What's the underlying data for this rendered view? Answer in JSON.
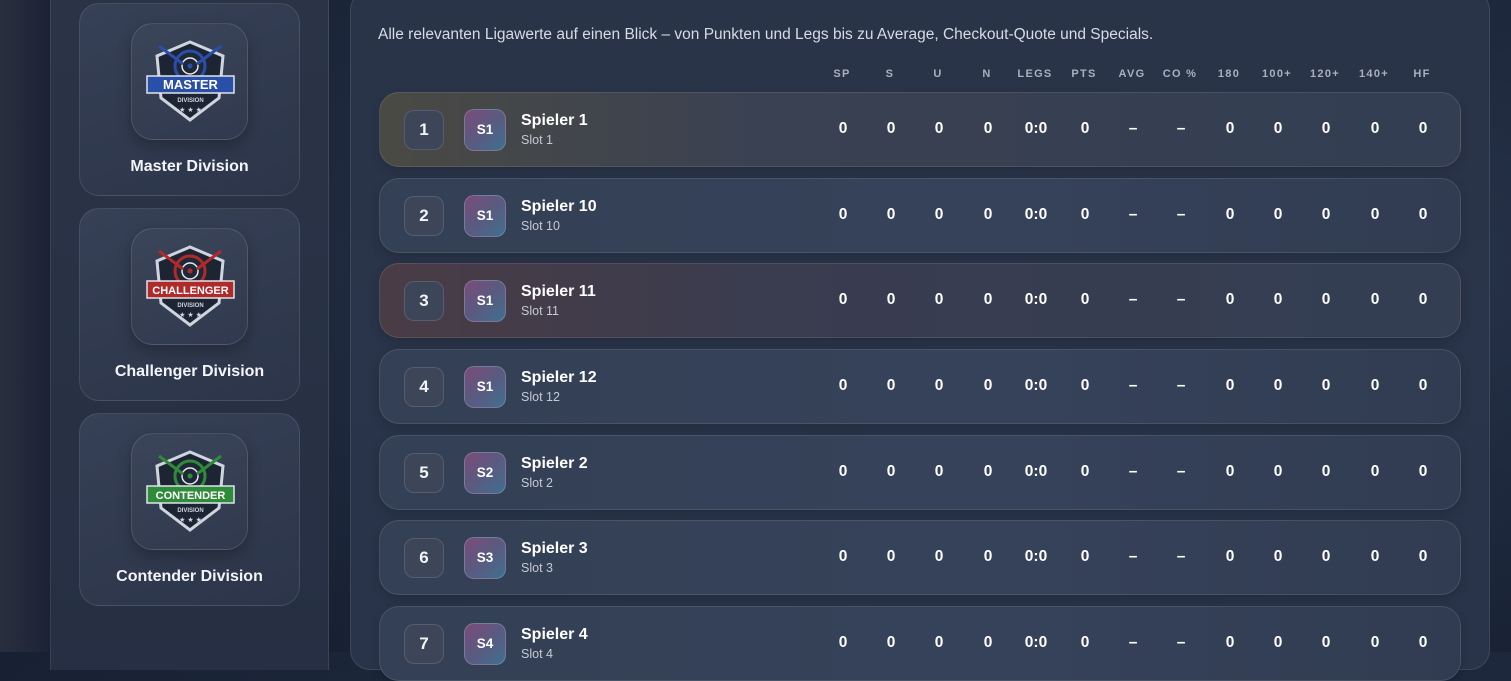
{
  "sidebar": {
    "divisions": [
      {
        "name": "Master Division",
        "badge_word": "MASTER",
        "badge_sub": "DIVISION",
        "color": "#2a4fa8"
      },
      {
        "name": "Challenger Division",
        "badge_word": "CHALLENGER",
        "badge_sub": "DIVISION",
        "color": "#b02a2a"
      },
      {
        "name": "Contender Division",
        "badge_word": "CONTENDER",
        "badge_sub": "DIVISION",
        "color": "#2f8a3a"
      }
    ]
  },
  "main": {
    "intro": "Alle relevanten Ligawerte auf einen Blick – von Punkten und Legs bis zu Average, Checkout-Quote und Specials.",
    "columns": [
      "SP",
      "S",
      "U",
      "N",
      "LEGS",
      "PTS",
      "AVG",
      "CO %",
      "180",
      "100+",
      "120+",
      "140+",
      "HF"
    ],
    "rows": [
      {
        "rank": "1",
        "avatar": "S1",
        "name": "Spieler 1",
        "slot": "Slot 1",
        "values": [
          "0",
          "0",
          "0",
          "0",
          "0:0",
          "0",
          "–",
          "–",
          "0",
          "0",
          "0",
          "0",
          "0"
        ]
      },
      {
        "rank": "2",
        "avatar": "S1",
        "name": "Spieler 10",
        "slot": "Slot 10",
        "values": [
          "0",
          "0",
          "0",
          "0",
          "0:0",
          "0",
          "–",
          "–",
          "0",
          "0",
          "0",
          "0",
          "0"
        ]
      },
      {
        "rank": "3",
        "avatar": "S1",
        "name": "Spieler 11",
        "slot": "Slot 11",
        "values": [
          "0",
          "0",
          "0",
          "0",
          "0:0",
          "0",
          "–",
          "–",
          "0",
          "0",
          "0",
          "0",
          "0"
        ]
      },
      {
        "rank": "4",
        "avatar": "S1",
        "name": "Spieler 12",
        "slot": "Slot 12",
        "values": [
          "0",
          "0",
          "0",
          "0",
          "0:0",
          "0",
          "–",
          "–",
          "0",
          "0",
          "0",
          "0",
          "0"
        ]
      },
      {
        "rank": "5",
        "avatar": "S2",
        "name": "Spieler 2",
        "slot": "Slot 2",
        "values": [
          "0",
          "0",
          "0",
          "0",
          "0:0",
          "0",
          "–",
          "–",
          "0",
          "0",
          "0",
          "0",
          "0"
        ]
      },
      {
        "rank": "6",
        "avatar": "S3",
        "name": "Spieler 3",
        "slot": "Slot 3",
        "values": [
          "0",
          "0",
          "0",
          "0",
          "0:0",
          "0",
          "–",
          "–",
          "0",
          "0",
          "0",
          "0",
          "0"
        ]
      },
      {
        "rank": "7",
        "avatar": "S4",
        "name": "Spieler 4",
        "slot": "Slot 4",
        "values": [
          "0",
          "0",
          "0",
          "0",
          "0:0",
          "0",
          "–",
          "–",
          "0",
          "0",
          "0",
          "0",
          "0"
        ]
      }
    ]
  }
}
